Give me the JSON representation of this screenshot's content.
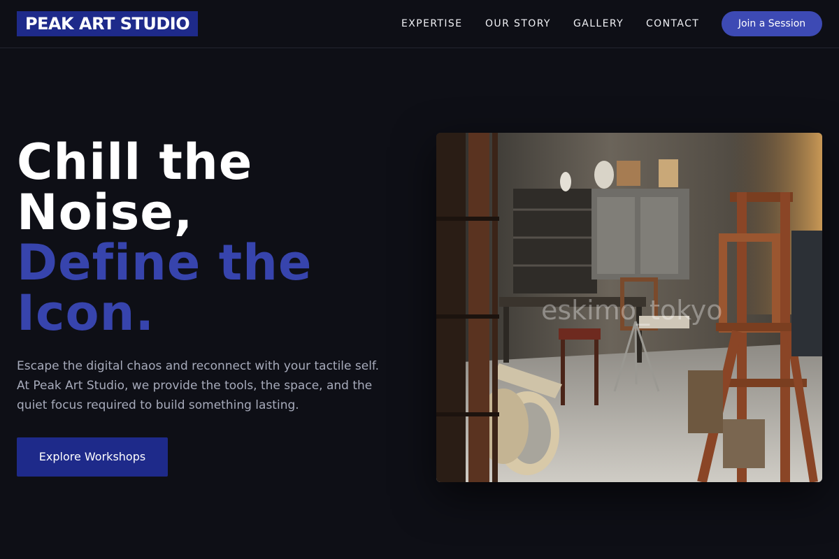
{
  "brand": {
    "logo_text": "PEAK ART STUDIO"
  },
  "nav": {
    "items": [
      {
        "label": "EXPERTISE"
      },
      {
        "label": "OUR STORY"
      },
      {
        "label": "GALLERY"
      },
      {
        "label": "CONTACT"
      }
    ],
    "cta_label": "Join a Session"
  },
  "hero": {
    "title_lines": [
      "Chill the",
      "Noise,"
    ],
    "accent_lines": [
      "Define the",
      "Icon."
    ],
    "description": "Escape the digital chaos and reconnect with your tactile self. At Peak Art Studio, we provide the tools, the space, and the quiet focus required to build something lasting.",
    "button_label": "Explore Workshops",
    "image_watermark": "eskimo_tokyo"
  },
  "colors": {
    "background": "#0e0f16",
    "brand_navy": "#1e2a8a",
    "accent": "#3744ad",
    "cta": "#3d4ab4",
    "body_text": "#a7abbb"
  }
}
